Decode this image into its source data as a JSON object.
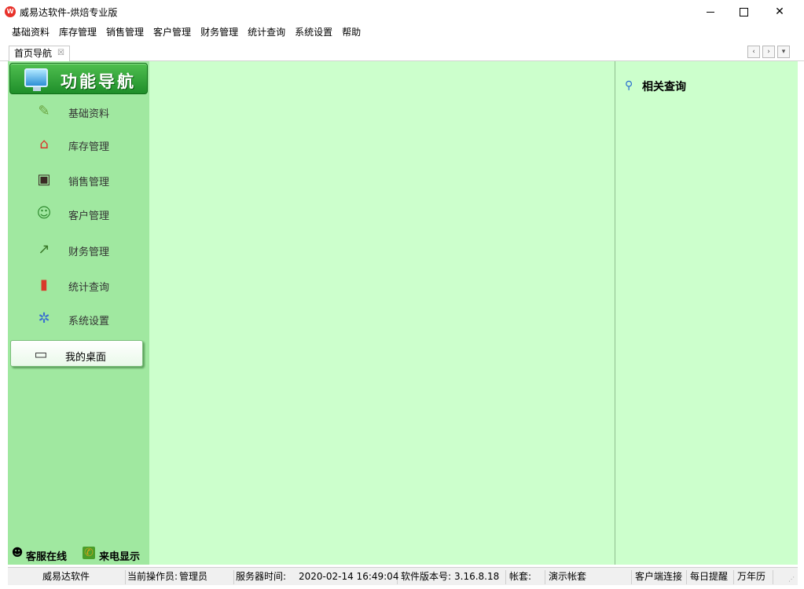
{
  "window": {
    "logo_text": "W",
    "title": "威易达软件-烘焙专业版",
    "minimize": "",
    "maximize": "",
    "close": "✕"
  },
  "menu": [
    "基础资料",
    "库存管理",
    "销售管理",
    "客户管理",
    "财务管理",
    "统计查询",
    "系统设置",
    "帮助"
  ],
  "tabs": {
    "active_label": "首页导航",
    "close_glyph": "☒",
    "nav_buttons": [
      "‹",
      "›",
      "▾"
    ]
  },
  "sidebar": {
    "header_title": "功能导航",
    "items": [
      {
        "label": "基础资料",
        "icon": "pencil-icon",
        "glyph": "✎",
        "color": "#6aa33f"
      },
      {
        "label": "库存管理",
        "icon": "house-icon",
        "glyph": "⌂",
        "color": "#d9362c"
      },
      {
        "label": "销售管理",
        "icon": "cash-register-icon",
        "glyph": "▣",
        "color": "#3a2a24"
      },
      {
        "label": "客户管理",
        "icon": "users-icon",
        "glyph": "☺",
        "color": "#2f8a2f"
      },
      {
        "label": "财务管理",
        "icon": "growth-chart-icon",
        "glyph": "↗",
        "color": "#3a7a2a"
      },
      {
        "label": "统计查询",
        "icon": "bar-chart-icon",
        "glyph": "▮",
        "color": "#d93a2a"
      },
      {
        "label": "系统设置",
        "icon": "gears-icon",
        "glyph": "✲",
        "color": "#3a6fd0"
      },
      {
        "label": "我的桌面",
        "icon": "desktop-icon",
        "glyph": "▭",
        "color": "#3a3a3a"
      }
    ],
    "footer": {
      "service_label": "客服在线",
      "caller_label": "来电显示"
    }
  },
  "right_panel": {
    "title": "相关查询"
  },
  "statusbar": {
    "company": "威易达软件",
    "operator_label": "当前操作员:",
    "operator": "管理员",
    "server_time_label": "服务器时间:",
    "server_time": "2020-02-14 16:49:04",
    "version_label": "软件版本号:",
    "version": "3.16.8.18",
    "account_label": "帐套:",
    "account": "演示帐套",
    "client_connect": "客户端连接",
    "daily_reminder": "每日提醒",
    "calendar": "万年历"
  },
  "colors": {
    "content_bg": "#ccffcc",
    "sidebar_bg": "#a0e8a0",
    "header_green": "#2e9a34"
  }
}
